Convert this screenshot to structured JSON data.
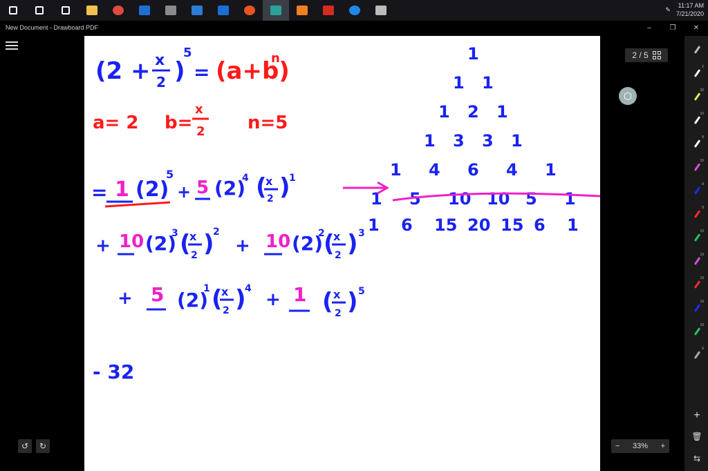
{
  "taskbar": {
    "icons": [
      {
        "name": "windows-start-icon",
        "color": "#ffffff"
      },
      {
        "name": "search-icon",
        "color": "#ffffff"
      },
      {
        "name": "task-view-icon",
        "color": "#ffffff"
      },
      {
        "name": "file-explorer-icon",
        "color": "#f2c14e"
      },
      {
        "name": "chrome-icon",
        "color": "#e04a3f"
      },
      {
        "name": "outlook-icon",
        "color": "#1f6fd1"
      },
      {
        "name": "screen-tool-icon",
        "color": "#8a8a8a"
      },
      {
        "name": "outlook-calendar-icon",
        "color": "#2b7cd3"
      },
      {
        "name": "mail-icon",
        "color": "#1a6fd4"
      },
      {
        "name": "ubuntu-icon",
        "color": "#e95420"
      },
      {
        "name": "drawboard-icon",
        "color": "#2aa198"
      },
      {
        "name": "camera-app-icon",
        "color": "#f08020"
      },
      {
        "name": "acrobat-icon",
        "color": "#d62b1f"
      },
      {
        "name": "edge-icon",
        "color": "#1e88e5"
      },
      {
        "name": "files-icon",
        "color": "#bbbbbb"
      }
    ],
    "time": "11:17 AM",
    "date": "7/21/2020"
  },
  "window": {
    "title": "New Document - Drawboard PDF",
    "minimize": "–",
    "maximize": "❐",
    "close": "✕"
  },
  "pager": {
    "label": "2 / 5"
  },
  "zoom": {
    "minus": "−",
    "value": "33%",
    "plus": "+"
  },
  "controls": {
    "undo": "↺",
    "redo": "↻",
    "hex": "⬡",
    "add": "+",
    "trash": "🗑",
    "swap": "⇆"
  },
  "tools": [
    {
      "name": "lasso-tool-icon",
      "color": "#bbbbbb",
      "num": ""
    },
    {
      "name": "pen-tool-icon",
      "color": "#ffffff",
      "num": "2"
    },
    {
      "name": "highlighter-tool-icon",
      "color": "#e8e85a",
      "num": "20"
    },
    {
      "name": "pen-tool-icon",
      "color": "#ffffff",
      "num": "10"
    },
    {
      "name": "pen-tool-icon",
      "color": "#ffffff",
      "num": "8"
    },
    {
      "name": "pen-tool-icon",
      "color": "#e04cd8",
      "num": "10"
    },
    {
      "name": "pen-tool-icon",
      "color": "#1a2bff",
      "num": "8"
    },
    {
      "name": "pen-tool-icon",
      "color": "#ff2a2a",
      "num": "8"
    },
    {
      "name": "pen-tool-icon",
      "color": "#22c55e",
      "num": "10"
    },
    {
      "name": "pen-tool-icon",
      "color": "#e04cd8",
      "num": "19"
    },
    {
      "name": "pen-tool-icon",
      "color": "#ff2a2a",
      "num": "19"
    },
    {
      "name": "pen-tool-icon",
      "color": "#1a2bff",
      "num": "19"
    },
    {
      "name": "pen-tool-icon",
      "color": "#22c55e",
      "num": "19"
    },
    {
      "name": "pen-tool-icon",
      "color": "#aaaaaa",
      "num": "6"
    }
  ],
  "ink": {
    "colors": {
      "blue": "#1a23f0",
      "red": "#ff1a1a",
      "magenta": "#f020c8"
    },
    "line1_a": "(2 +",
    "line1_x": "x",
    "line1_2": "2",
    "line1_b": ")",
    "line1_exp": "5",
    "line1_eq": "=",
    "line1_red": "(a+b)",
    "line1_n": "n",
    "line2_a": "a= 2",
    "line2_b": "b=",
    "line2_x": "x",
    "line2_2": "2",
    "line2_n": "n=5",
    "line3_eq": "=",
    "c1": "1",
    "t1": "(2)",
    "t1e": "5",
    "plus": "+",
    "c5": "5",
    "t2": "(2)",
    "t2e": "4",
    "x": "x",
    "two": "2",
    "one": "1",
    "c10": "10",
    "t3": "(2)",
    "t3e": "3",
    "sq": "2",
    "t4e": "2",
    "cube": "3",
    "t5e": "1",
    "p4": "4",
    "p5": "5",
    "result": "- 32",
    "pascal": [
      [
        "1"
      ],
      [
        "1",
        "1"
      ],
      [
        "1",
        "2",
        "1"
      ],
      [
        "1",
        "3",
        "3",
        "1"
      ],
      [
        "1",
        "4",
        "6",
        "4",
        "1"
      ],
      [
        "1",
        "5",
        "10",
        "10",
        "5",
        "1"
      ],
      [
        "1",
        "6",
        "15",
        "20",
        "15",
        "6",
        "1"
      ]
    ]
  }
}
